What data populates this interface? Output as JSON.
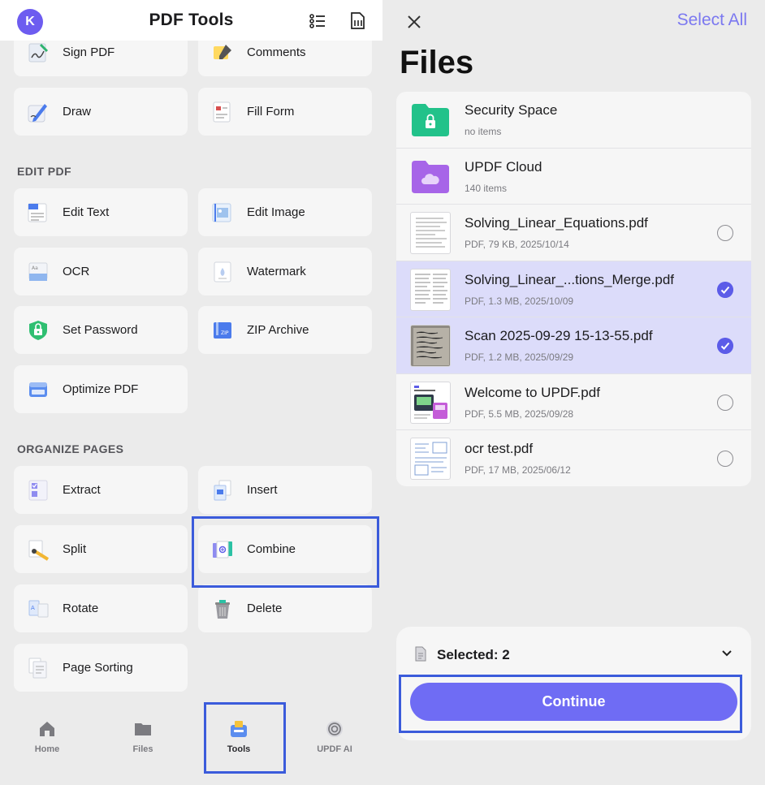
{
  "left": {
    "header": {
      "avatar_letter": "K",
      "title": "PDF Tools"
    },
    "tools_top": [
      {
        "label": "Sign PDF",
        "icon": "sign-pdf-icon"
      },
      {
        "label": "Comments",
        "icon": "comments-icon"
      },
      {
        "label": "Draw",
        "icon": "draw-icon"
      },
      {
        "label": "Fill Form",
        "icon": "fill-form-icon"
      }
    ],
    "sections": {
      "edit_pdf": {
        "title": "EDIT PDF",
        "items": [
          {
            "label": "Edit Text",
            "icon": "edit-text-icon"
          },
          {
            "label": "Edit Image",
            "icon": "edit-image-icon"
          },
          {
            "label": "OCR",
            "icon": "ocr-icon"
          },
          {
            "label": "Watermark",
            "icon": "watermark-icon"
          },
          {
            "label": "Set Password",
            "icon": "set-password-icon"
          },
          {
            "label": "ZIP Archive",
            "icon": "zip-archive-icon"
          },
          {
            "label": "Optimize PDF",
            "icon": "optimize-pdf-icon"
          }
        ]
      },
      "organize_pages": {
        "title": "ORGANIZE PAGES",
        "items": [
          {
            "label": "Extract",
            "icon": "extract-icon"
          },
          {
            "label": "Insert",
            "icon": "insert-icon"
          },
          {
            "label": "Split",
            "icon": "split-icon"
          },
          {
            "label": "Combine",
            "icon": "combine-icon"
          },
          {
            "label": "Rotate",
            "icon": "rotate-icon"
          },
          {
            "label": "Delete",
            "icon": "delete-icon"
          },
          {
            "label": "Page Sorting",
            "icon": "page-sorting-icon"
          }
        ]
      }
    },
    "bottom_nav": [
      {
        "label": "Home",
        "icon": "home-icon"
      },
      {
        "label": "Files",
        "icon": "files-icon"
      },
      {
        "label": "Tools",
        "icon": "tools-icon",
        "active": true
      },
      {
        "label": "UPDF AI",
        "icon": "updf-ai-icon"
      }
    ]
  },
  "right": {
    "header": {
      "select_all": "Select All",
      "title": "Files"
    },
    "files": [
      {
        "name": "Security Space",
        "meta": "no items",
        "type": "folder",
        "color": "#22c28a"
      },
      {
        "name": "UPDF Cloud",
        "meta": "140 items",
        "type": "folder",
        "color": "#a765e8"
      },
      {
        "name": "Solving_Linear_Equations.pdf",
        "meta": "PDF, 79 KB, 2025/10/14",
        "type": "pdf",
        "selected": false
      },
      {
        "name": "Solving_Linear_...tions_Merge.pdf",
        "meta": "PDF, 1.3 MB, 2025/10/09",
        "type": "pdf",
        "selected": true
      },
      {
        "name": "Scan 2025-09-29 15-13-55.pdf",
        "meta": "PDF, 1.2 MB, 2025/09/29",
        "type": "scan",
        "selected": true
      },
      {
        "name": "Welcome to UPDF.pdf",
        "meta": "PDF, 5.5 MB, 2025/09/28",
        "type": "pdf",
        "selected": false
      },
      {
        "name": "ocr test.pdf",
        "meta": "PDF, 17 MB, 2025/06/12",
        "type": "pdf",
        "selected": false
      }
    ],
    "sheet": {
      "selected_label": "Selected: 2",
      "continue_label": "Continue"
    }
  },
  "colors": {
    "accent": "#6f6cf4",
    "highlight_border": "#3b5bdb",
    "selected_row": "#dcdcfa"
  }
}
